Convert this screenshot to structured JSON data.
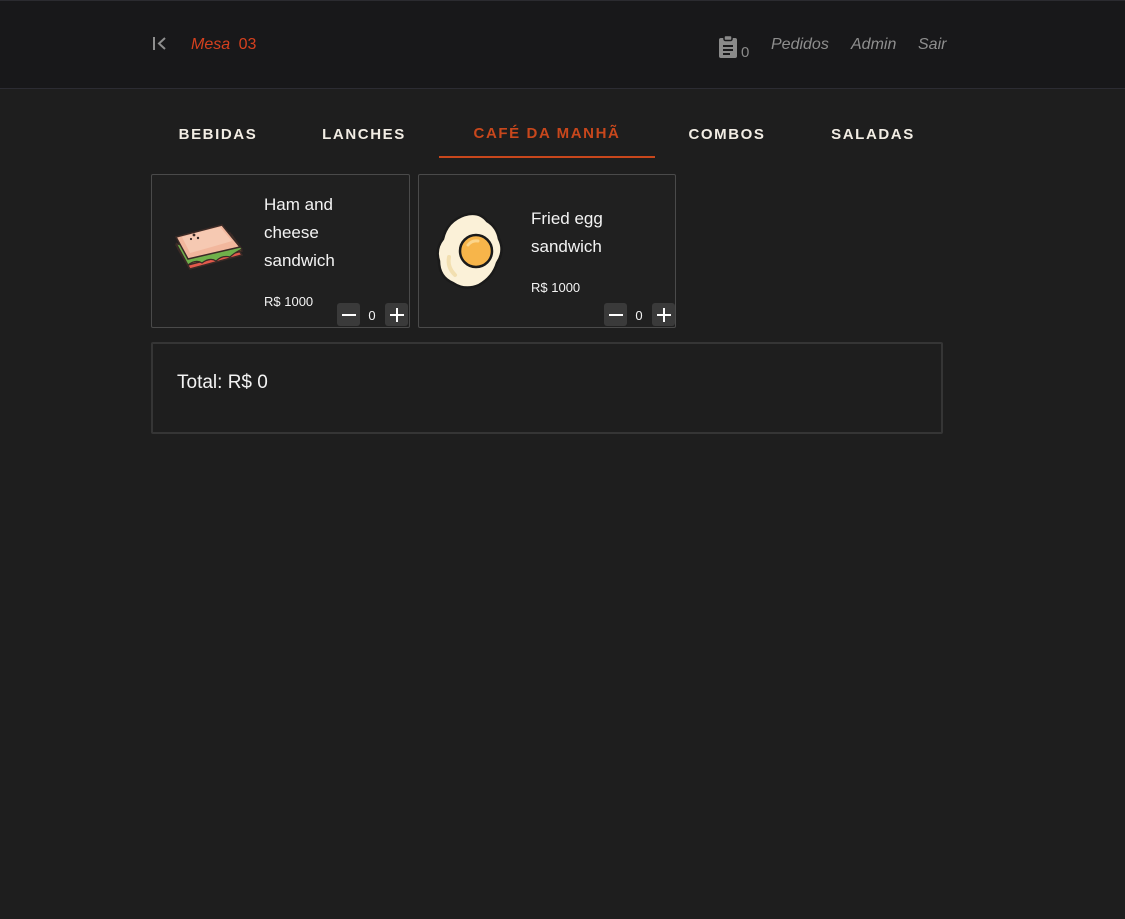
{
  "header": {
    "mesa_label": "Mesa",
    "mesa_number": "03",
    "orders_count": "0",
    "nav": [
      {
        "label": "Pedidos"
      },
      {
        "label": "Admin"
      },
      {
        "label": "Sair"
      }
    ]
  },
  "tabs": [
    {
      "label": "BEBIDAS",
      "active": false
    },
    {
      "label": "LANCHES",
      "active": false
    },
    {
      "label": "CAFÉ DA MANHÃ",
      "active": true
    },
    {
      "label": "COMBOS",
      "active": false
    },
    {
      "label": "SALADAS",
      "active": false
    }
  ],
  "products": [
    {
      "name_lines": [
        "Ham and",
        "cheese",
        "sandwich"
      ],
      "price": "R$ 1000",
      "quantity": "0",
      "icon": "sandwich-icon"
    },
    {
      "name_lines": [
        "Fried egg",
        "sandwich"
      ],
      "price": "R$ 1000",
      "quantity": "0",
      "icon": "fried-egg-icon"
    }
  ],
  "total": {
    "text": "Total: R$ 0"
  },
  "colors": {
    "accent": "#c8471c",
    "background": "#1e1e1e",
    "header_bg": "#18181a"
  }
}
